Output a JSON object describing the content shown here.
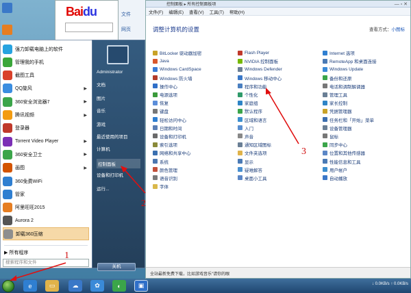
{
  "browser": {
    "logo": "Bai",
    "logo_b": "du",
    "side_items": [
      "文件",
      "网页"
    ]
  },
  "control_panel": {
    "address": "控制面板  ▸  所有控制面板项",
    "menu": [
      "文件(F)",
      "编辑(E)",
      "查看(V)",
      "工具(T)",
      "帮助(H)"
    ],
    "title": "调整计算机的设置",
    "view_label": "查看方式：",
    "view_value": "小图标",
    "columns": [
      [
        {
          "label": "BitLocker 驱动器加密",
          "color": "#c9a227"
        },
        {
          "label": "Java",
          "color": "#d9572b"
        },
        {
          "label": "Windows CardSpace",
          "color": "#3a7bd5"
        },
        {
          "label": "Windows 防火墙",
          "color": "#b23b2a"
        },
        {
          "label": "操作中心",
          "color": "#2f6fc8"
        },
        {
          "label": "电源选项",
          "color": "#3b9a3b"
        },
        {
          "label": "恢复",
          "color": "#5b8dd9"
        },
        {
          "label": "键盘",
          "color": "#777777"
        },
        {
          "label": "轻松访问中心",
          "color": "#2f7fd1"
        },
        {
          "label": "日期和时间",
          "color": "#5a7fb5"
        },
        {
          "label": "设备和打印机",
          "color": "#6a6a6a"
        },
        {
          "label": "索引选项",
          "color": "#8a8a3a"
        },
        {
          "label": "网络和共享中心",
          "color": "#3a6fb0"
        },
        {
          "label": "系统",
          "color": "#4b77b0"
        },
        {
          "label": "颜色管理",
          "color": "#c2503a"
        },
        {
          "label": "语音识别",
          "color": "#7a7a7a"
        },
        {
          "label": "字体",
          "color": "#d9b84a"
        }
      ],
      [
        {
          "label": "Flash Player",
          "color": "#c0392b"
        },
        {
          "label": "NVIDIA 控制面板",
          "color": "#76b900"
        },
        {
          "label": "Windows Defender",
          "color": "#6b7f96"
        },
        {
          "label": "Windows 移动中心",
          "color": "#3a78c8"
        },
        {
          "label": "程序和功能",
          "color": "#4a7fc0"
        },
        {
          "label": "个性化",
          "color": "#2f9a6a"
        },
        {
          "label": "家庭组",
          "color": "#2d84c6"
        },
        {
          "label": "默认程序",
          "color": "#3ba54a"
        },
        {
          "label": "区域和语言",
          "color": "#3c8fcf"
        },
        {
          "label": "入门",
          "color": "#5a8fd0"
        },
        {
          "label": "声音",
          "color": "#888888"
        },
        {
          "label": "通知区域图标",
          "color": "#6a7f95"
        },
        {
          "label": "文件夹选项",
          "color": "#e0b34a"
        },
        {
          "label": "显示",
          "color": "#4a7ab5"
        },
        {
          "label": "疑难解答",
          "color": "#4a90d0"
        },
        {
          "label": "桌面小工具",
          "color": "#5b86c6"
        }
      ],
      [
        {
          "label": "Internet 选项",
          "color": "#2f7fd1"
        },
        {
          "label": "RemoteApp 和桌面连接",
          "color": "#4a7ab5"
        },
        {
          "label": "Windows Update",
          "color": "#3a8ad8"
        },
        {
          "label": "备份和还原",
          "color": "#3ba54a"
        },
        {
          "label": "电话和调制解调器",
          "color": "#777777"
        },
        {
          "label": "管理工具",
          "color": "#6a7f95"
        },
        {
          "label": "家长控制",
          "color": "#2f84c6"
        },
        {
          "label": "凭据管理器",
          "color": "#c9a227"
        },
        {
          "label": "任务栏和「开始」菜单",
          "color": "#3c6fb0"
        },
        {
          "label": "设备管理器",
          "color": "#6a7f95"
        },
        {
          "label": "鼠标",
          "color": "#777777"
        },
        {
          "label": "同步中心",
          "color": "#3ba54a"
        },
        {
          "label": "位置和其他传感器",
          "color": "#5b86c6"
        },
        {
          "label": "性能信息和工具",
          "color": "#4a7ab5"
        },
        {
          "label": "用户帐户",
          "color": "#3c8fcf"
        },
        {
          "label": "自动播放",
          "color": "#3a78c8"
        }
      ]
    ],
    "status_ad": "全站最新免费下载，比如游戏音乐\"请你的眼"
  },
  "start_menu": {
    "programs": [
      {
        "label": "强力卸载电脑上的软件",
        "color": "#27a3e0",
        "arrow": false
      },
      {
        "label": "管理我的手机",
        "color": "#3aa63a",
        "arrow": false
      },
      {
        "label": "截图工具",
        "color": "#d9412b",
        "arrow": false
      },
      {
        "label": "QQ旋风",
        "color": "#3a8de0",
        "arrow": true
      },
      {
        "label": "360安全浏览器7",
        "color": "#3ba54a",
        "arrow": true
      },
      {
        "label": "腾讯视频",
        "color": "#f39c12",
        "arrow": true
      },
      {
        "label": "登录器",
        "color": "#c0392b",
        "arrow": false
      },
      {
        "label": "Torrent Video Player",
        "color": "#7b2fb5",
        "arrow": true
      },
      {
        "label": "360安全卫士",
        "color": "#3ba54a",
        "arrow": true
      },
      {
        "label": "画图",
        "color": "#d35400",
        "arrow": true
      },
      {
        "label": "360免费WiFi",
        "color": "#2f7fd1",
        "arrow": false
      },
      {
        "label": "管家",
        "color": "#2f7fd1",
        "arrow": false
      },
      {
        "label": "阿里旺旺2015",
        "color": "#e67e22",
        "arrow": false
      },
      {
        "label": "Aurora 2",
        "color": "#555555",
        "arrow": false
      },
      {
        "label": "卸载360压缩",
        "color": "#8e8e8e",
        "arrow": false
      }
    ],
    "all_programs": "所有程序",
    "search_placeholder": "搜索程序和文件",
    "right_items": [
      "Administrator",
      "文档",
      "图片",
      "音乐",
      "游戏",
      "最近使用的项目",
      "计算机",
      "控制面板",
      "设备和打印机",
      "运行..."
    ],
    "shutdown": "关机"
  },
  "taskbar": {
    "tray": "↓ 0.0KB/s ↑ 0.0KB/s"
  },
  "annotations": [
    "1",
    "2",
    "3"
  ]
}
